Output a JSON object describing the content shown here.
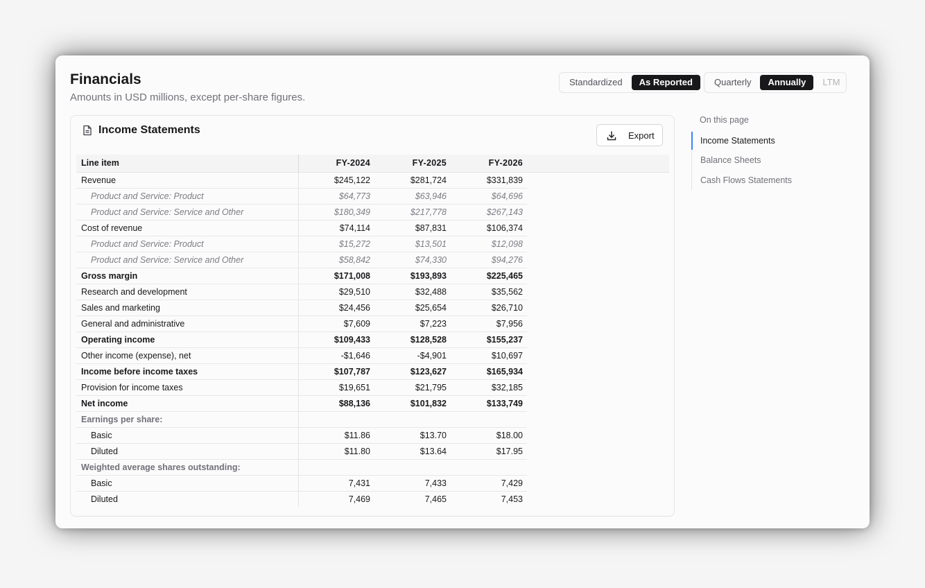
{
  "header": {
    "title": "Financials",
    "subtitle": "Amounts in USD millions, except per-share figures."
  },
  "basis_toggle": {
    "options": [
      "Standardized",
      "As Reported"
    ],
    "selected": "As Reported"
  },
  "period_toggle": {
    "options": [
      "Quarterly",
      "Annually",
      "LTM"
    ],
    "selected": "Annually",
    "disabled": [
      "LTM"
    ]
  },
  "card": {
    "title": "Income Statements",
    "icon": "document-icon",
    "export_label": "Export",
    "export_icon": "download-icon"
  },
  "table": {
    "columns": [
      "Line item",
      "FY-2024",
      "FY-2025",
      "FY-2026"
    ],
    "rows": [
      {
        "label": "Revenue",
        "values": [
          "$245,122",
          "$281,724",
          "$331,839"
        ],
        "style": "normal"
      },
      {
        "label": "Product and Service: Product",
        "values": [
          "$64,773",
          "$63,946",
          "$64,696"
        ],
        "style": "sub"
      },
      {
        "label": "Product and Service: Service and Other",
        "values": [
          "$180,349",
          "$217,778",
          "$267,143"
        ],
        "style": "sub"
      },
      {
        "label": "Cost of revenue",
        "values": [
          "$74,114",
          "$87,831",
          "$106,374"
        ],
        "style": "normal"
      },
      {
        "label": "Product and Service: Product",
        "values": [
          "$15,272",
          "$13,501",
          "$12,098"
        ],
        "style": "sub"
      },
      {
        "label": "Product and Service: Service and Other",
        "values": [
          "$58,842",
          "$74,330",
          "$94,276"
        ],
        "style": "sub"
      },
      {
        "label": "Gross margin",
        "values": [
          "$171,008",
          "$193,893",
          "$225,465"
        ],
        "style": "bold"
      },
      {
        "label": "Research and development",
        "values": [
          "$29,510",
          "$32,488",
          "$35,562"
        ],
        "style": "normal"
      },
      {
        "label": "Sales and marketing",
        "values": [
          "$24,456",
          "$25,654",
          "$26,710"
        ],
        "style": "normal"
      },
      {
        "label": "General and administrative",
        "values": [
          "$7,609",
          "$7,223",
          "$7,956"
        ],
        "style": "normal"
      },
      {
        "label": "Operating income",
        "values": [
          "$109,433",
          "$128,528",
          "$155,237"
        ],
        "style": "bold"
      },
      {
        "label": "Other income (expense), net",
        "values": [
          "-$1,646",
          "-$4,901",
          "$10,697"
        ],
        "style": "normal"
      },
      {
        "label": "Income before income taxes",
        "values": [
          "$107,787",
          "$123,627",
          "$165,934"
        ],
        "style": "bold"
      },
      {
        "label": "Provision for income taxes",
        "values": [
          "$19,651",
          "$21,795",
          "$32,185"
        ],
        "style": "normal"
      },
      {
        "label": "Net income",
        "values": [
          "$88,136",
          "$101,832",
          "$133,749"
        ],
        "style": "bold"
      },
      {
        "label": "Earnings per share:",
        "values": [
          "",
          "",
          ""
        ],
        "style": "section"
      },
      {
        "label": "Basic",
        "values": [
          "$11.86",
          "$13.70",
          "$18.00"
        ],
        "style": "indent"
      },
      {
        "label": "Diluted",
        "values": [
          "$11.80",
          "$13.64",
          "$17.95"
        ],
        "style": "indent"
      },
      {
        "label": "Weighted average shares outstanding:",
        "values": [
          "",
          "",
          ""
        ],
        "style": "section"
      },
      {
        "label": "Basic",
        "values": [
          "7,431",
          "7,433",
          "7,429"
        ],
        "style": "indent"
      },
      {
        "label": "Diluted",
        "values": [
          "7,469",
          "7,465",
          "7,453"
        ],
        "style": "indent"
      }
    ]
  },
  "toc": {
    "heading": "On this page",
    "items": [
      {
        "label": "Income Statements",
        "active": true
      },
      {
        "label": "Balance Sheets",
        "active": false
      },
      {
        "label": "Cash Flows Statements",
        "active": false
      }
    ]
  },
  "colors": {
    "accent": "#3b82f6",
    "active_toggle": "#18181b"
  }
}
